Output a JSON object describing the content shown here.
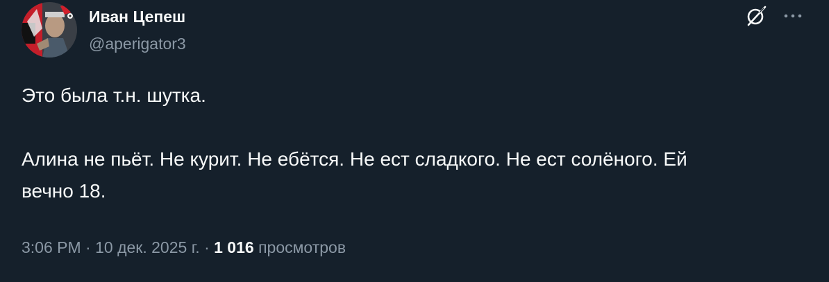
{
  "author": {
    "display_name": "Иван Цепеш",
    "handle": "@aperigator3"
  },
  "icons": {
    "grok": "grok-icon",
    "more": "more-dots-icon",
    "avatar": "profile-avatar"
  },
  "tweet": {
    "line1": "Это была т.н. шутка.",
    "line2": "Алина не пьёт. Не курит. Не ебётся. Не ест сладкого. Не ест солёного. Ей",
    "line3": "вечно 18."
  },
  "meta": {
    "time": "3:06 PM",
    "separator1": "·",
    "date": "10 дек. 2025 г.",
    "separator2": "·",
    "views_count": "1 016",
    "views_label": "просмотров"
  },
  "colors": {
    "background": "#15202b",
    "primary_text": "#f7f9f9",
    "secondary_text": "#8b98a5"
  }
}
